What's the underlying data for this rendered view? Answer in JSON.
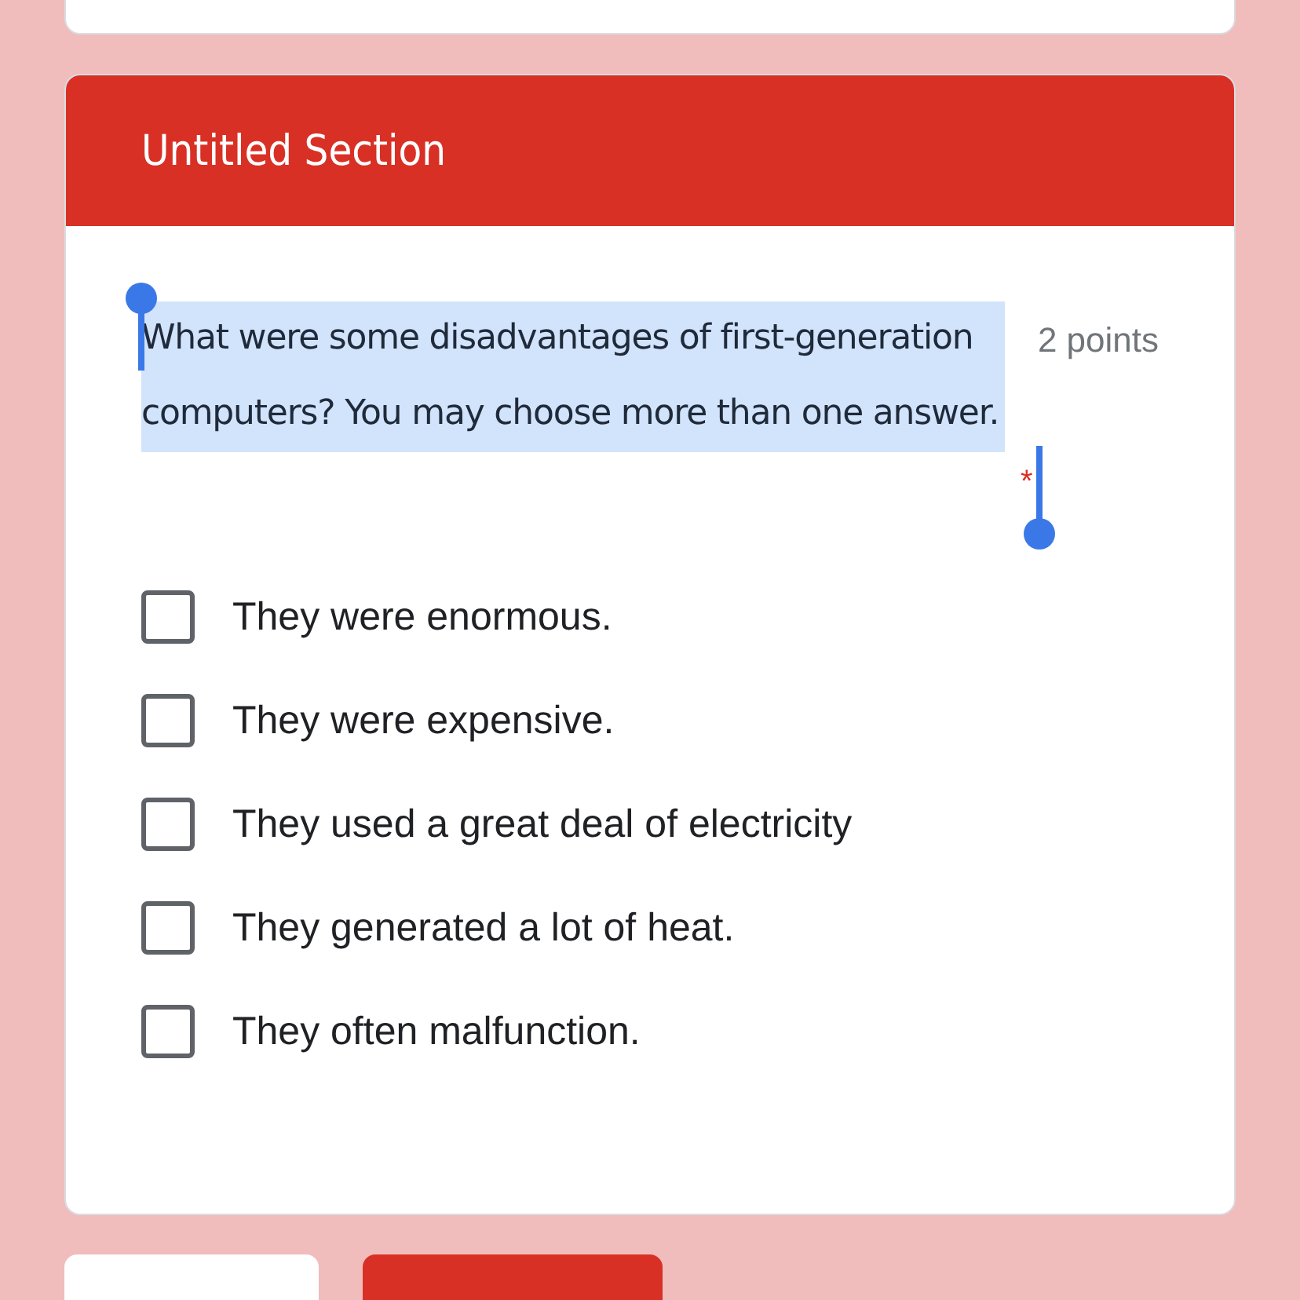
{
  "section": {
    "title": "Untitled Section"
  },
  "question": {
    "text": "What were some disadvantages of first-generation computers? You may choose more than one answer.",
    "selected": true,
    "required_mark": "*",
    "points": "2 points"
  },
  "options": [
    {
      "label": "They were enormous.",
      "checked": false
    },
    {
      "label": "They were expensive.",
      "checked": false
    },
    {
      "label": "They used a great deal of electricity",
      "checked": false
    },
    {
      "label": "They generated a lot of heat.",
      "checked": false
    },
    {
      "label": "They often malfunction.",
      "checked": false
    }
  ],
  "buttons": [
    {
      "kind": "secondary"
    },
    {
      "kind": "primary"
    }
  ]
}
